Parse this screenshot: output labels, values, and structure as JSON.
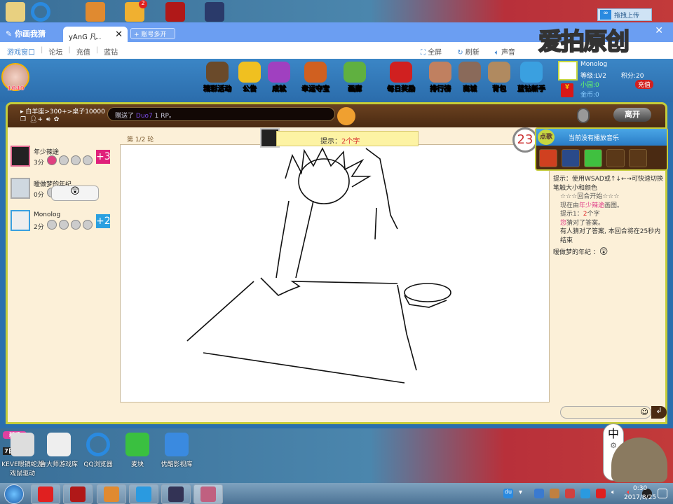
{
  "desktop_top": {
    "upload_label": "拖拽上传",
    "icons": [
      "folder",
      "qq-browser",
      "game-helper",
      "game-badge-2",
      "ni",
      "galaxy-game"
    ],
    "badge_count": "2"
  },
  "window": {
    "app_title": "你画我猜",
    "tab_label": "yAnG  凡..",
    "new_tab_label": "账号多开",
    "watermark": "爱拍原创",
    "close": "✕",
    "nav_left": [
      "游戏窗口",
      "论坛",
      "充值",
      "蓝钻"
    ],
    "nav_right": [
      "全屏",
      "刷新",
      "声音"
    ]
  },
  "game": {
    "my_level_score": "1040",
    "menu": [
      "精彩活动",
      "公告",
      "成就",
      "幸运夺宝",
      "画廊",
      "每日奖励",
      "排行榜",
      "商城",
      "背包",
      "蓝钻新手"
    ],
    "profile": {
      "name": "Monolog",
      "level_label": "等级:",
      "level": "LV2",
      "points_label": "积分:",
      "points": "20",
      "xiaoyuan_label": "小园:",
      "xiaoyuan": "0",
      "coins_label": "金币:",
      "coins": "0",
      "recharge": "充值",
      "red_packet": "¥"
    },
    "room": {
      "name": "白羊座>300+>桌子10000",
      "message_prefix": "赠送了",
      "message_name": "Duo7",
      "message_suffix": "1 RP。",
      "leave": "离开"
    },
    "round": "第 1/2 轮",
    "hint_label": "提示：",
    "hint_value": "2个字",
    "timer": "23",
    "players": [
      {
        "name": "年少辣途",
        "score": "3分",
        "bonus": "+3",
        "color": "#e0207a"
      },
      {
        "name": "暧做梦的年纪",
        "score": "0分",
        "bonus": "",
        "color": ""
      },
      {
        "name": "Monolog",
        "score": "2分",
        "bonus": "+2",
        "color": "#2aa0e0"
      }
    ],
    "music": {
      "button": "点歌",
      "now_playing": "当前没有播放音乐"
    },
    "chat": {
      "tip": "提示：使用WSAD或↑↓←→可快速切换笔触大小和颜色",
      "round_start": "☆☆☆回合开始☆☆☆",
      "drawer_prefix": "现在由",
      "drawer_name": "年少辣途",
      "drawer_suffix": "画图。",
      "hint1_prefix": "提示1：",
      "hint1_num": "2",
      "hint1_suffix": "个字",
      "you": "您",
      "guessed": "猜对了答案。",
      "someone": "有人猜对了答案, 本回合将在25秒内结束",
      "last_speaker": "暧做梦的年纪 ：",
      "emoji": "😲"
    },
    "send": "↲",
    "gift": {
      "top": "新手",
      "bottom": "7日礼包"
    }
  },
  "desktop_icons": [
    "KEVE眼镜蛇游戏鼠驱动",
    "鲁大师游戏库",
    "QQ浏览器",
    "麦块",
    "优酷影视库"
  ],
  "taskbar": {
    "ime": "中",
    "tray_du": "du",
    "time": "0:30",
    "date": "2017/8/25"
  }
}
